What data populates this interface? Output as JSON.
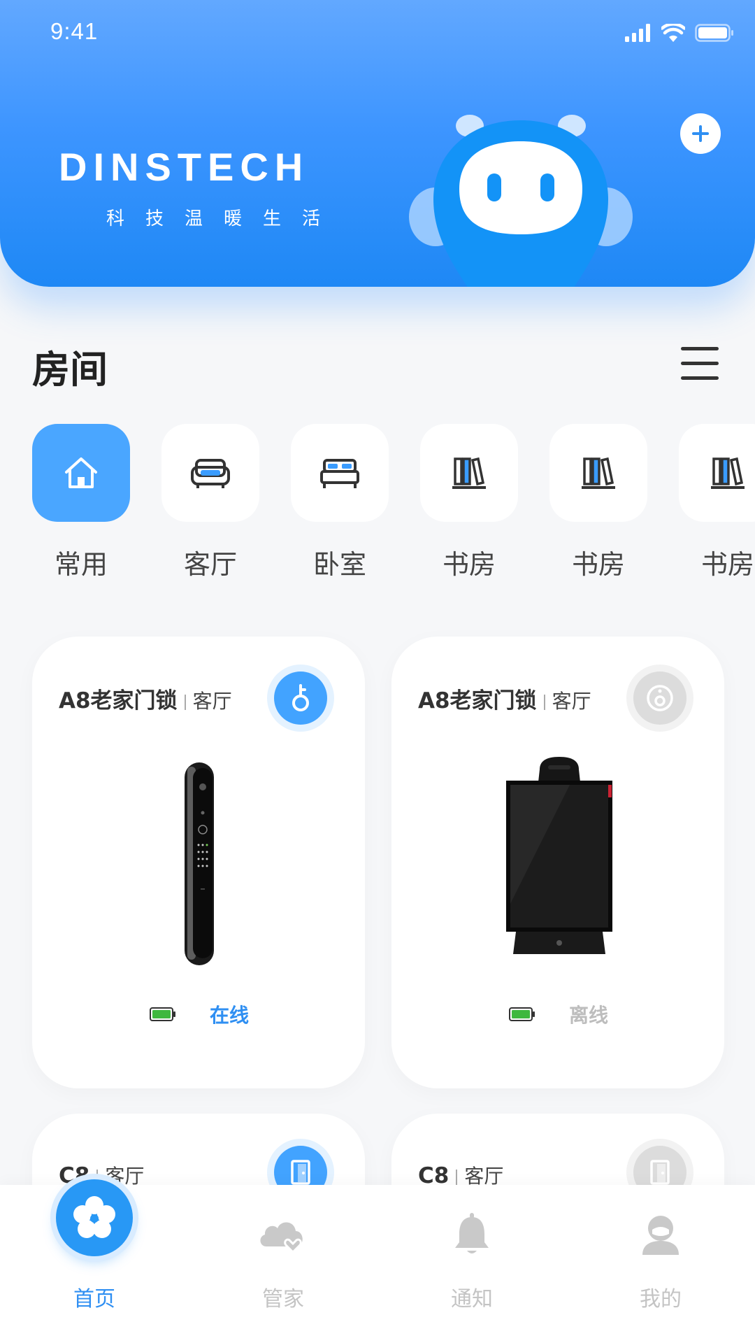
{
  "status_bar": {
    "time": "9:41"
  },
  "header": {
    "brand": "DINSTECH",
    "slogan": "科技温暖生活",
    "add_icon": "plus-circle-icon",
    "mascot": "robot-mascot-illustration"
  },
  "rooms": {
    "title": "房间",
    "menu_icon": "hamburger-menu-icon",
    "tabs": [
      {
        "label": "常用",
        "icon": "home-icon",
        "active": true
      },
      {
        "label": "客厅",
        "icon": "sofa-icon",
        "active": false
      },
      {
        "label": "卧室",
        "icon": "bed-icon",
        "active": false
      },
      {
        "label": "书房",
        "icon": "bookshelf-icon",
        "active": false
      },
      {
        "label": "书房",
        "icon": "bookshelf-icon",
        "active": false
      },
      {
        "label": "书房",
        "icon": "bookshelf-icon",
        "active": false
      }
    ]
  },
  "devices": [
    {
      "name": "A8老家门锁",
      "room": "客厅",
      "action_icon": "key-icon",
      "online": true,
      "status": "在线",
      "battery_icon": "battery-full-icon"
    },
    {
      "name": "A8老家门锁",
      "room": "客厅",
      "action_icon": "camera-icon",
      "online": false,
      "status": "离线",
      "battery_icon": "battery-full-icon"
    },
    {
      "name": "C8",
      "room": "客厅",
      "action_icon": "door-icon",
      "online": true
    },
    {
      "name": "C8",
      "room": "客厅",
      "action_icon": "door-icon",
      "online": false
    }
  ],
  "tabbar": {
    "items": [
      {
        "label": "首页",
        "icon": "flower-home-icon",
        "active": true
      },
      {
        "label": "管家",
        "icon": "cloud-heart-icon",
        "active": false
      },
      {
        "label": "通知",
        "icon": "bell-icon",
        "active": false
      },
      {
        "label": "我的",
        "icon": "user-icon",
        "active": false
      }
    ]
  },
  "colors": {
    "accent": "#42a3ff",
    "online": "#2f8ff2",
    "offline": "#bdbdbd",
    "battery": "#3fb83f"
  }
}
